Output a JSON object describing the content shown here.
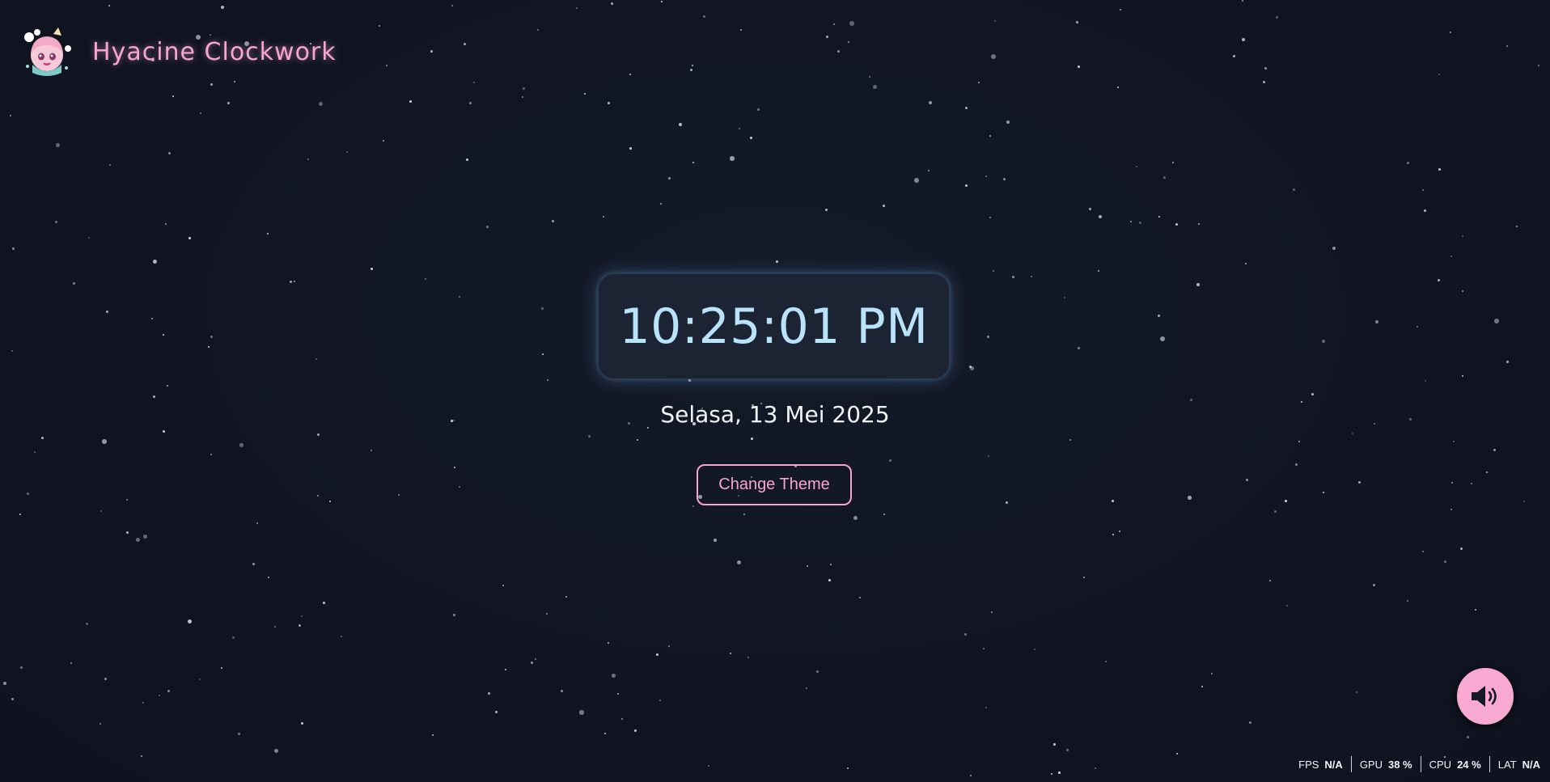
{
  "app": {
    "title": "Hyacine Clockwork",
    "logo_icon": "chibi-character-logo"
  },
  "clock": {
    "time": "10:25:01 PM",
    "date": "Selasa, 13 Mei 2025"
  },
  "theme_button": {
    "label": "Change Theme"
  },
  "sound_button": {
    "icon": "speaker-volume-icon"
  },
  "stats": [
    {
      "label": "FPS",
      "value": "N/A"
    },
    {
      "label": "GPU",
      "value": "38 %"
    },
    {
      "label": "CPU",
      "value": "24 %"
    },
    {
      "label": "LAT",
      "value": "N/A"
    }
  ],
  "colors": {
    "background": "#111522",
    "accent_pink": "#f6a6cd",
    "clock_text": "#b8e3fb",
    "clock_card": "#1c2433",
    "sound_button": "#f8a9d2"
  }
}
